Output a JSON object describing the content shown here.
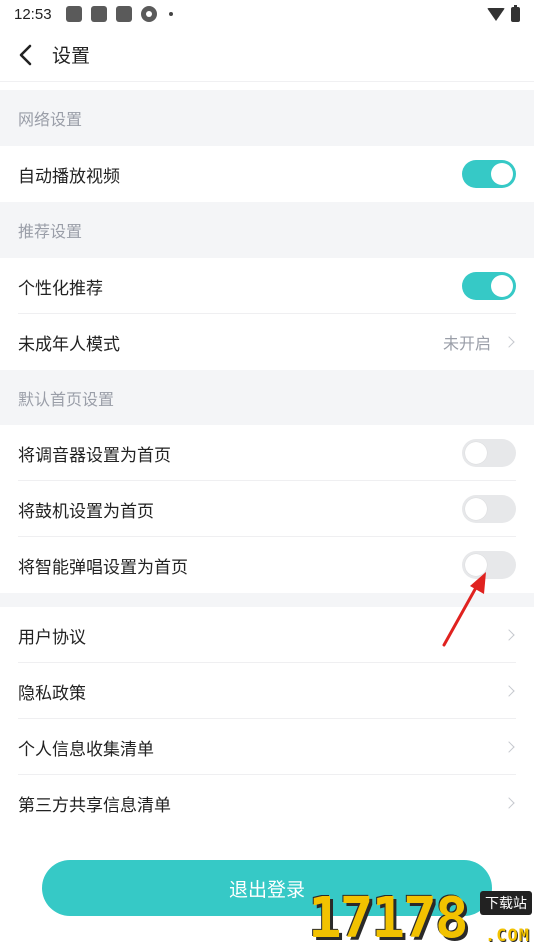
{
  "status_bar": {
    "time": "12:53"
  },
  "nav": {
    "title": "设置"
  },
  "sections": {
    "network": {
      "header": "网络设置",
      "autoplay_label": "自动播放视频",
      "autoplay_on": true
    },
    "recommend": {
      "header": "推荐设置",
      "personalized_label": "个性化推荐",
      "personalized_on": true,
      "minor_mode_label": "未成年人模式",
      "minor_mode_value": "未开启"
    },
    "default_home": {
      "header": "默认首页设置",
      "tuner_label": "将调音器设置为首页",
      "tuner_on": false,
      "drum_label": "将鼓机设置为首页",
      "drum_on": false,
      "smart_label": "将智能弹唱设置为首页",
      "smart_on": false
    },
    "legal": {
      "user_agreement": "用户协议",
      "privacy_policy": "隐私政策",
      "personal_info_list": "个人信息收集清单",
      "third_party_list": "第三方共享信息清单"
    }
  },
  "logout_label": "退出登录",
  "watermark": {
    "number": "17178",
    "badge": "下载站",
    "domain": ".COM"
  },
  "colors": {
    "accent": "#36c9c6",
    "section_bg": "#f4f5f7",
    "annotation_arrow": "#e0221f"
  }
}
